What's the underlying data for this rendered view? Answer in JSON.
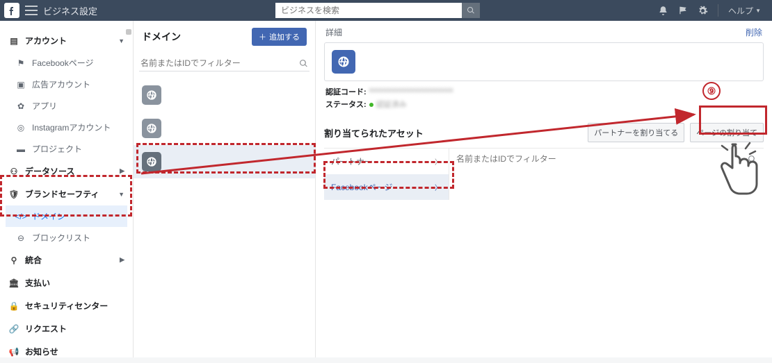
{
  "topbar": {
    "title": "ビジネス設定",
    "search_placeholder": "ビジネスを検索",
    "help": "ヘルプ"
  },
  "sidebar": {
    "accounts": {
      "label": "アカウント",
      "items": [
        {
          "label": "Facebookページ"
        },
        {
          "label": "広告アカウント"
        },
        {
          "label": "アプリ"
        },
        {
          "label": "Instagramアカウント"
        },
        {
          "label": "プロジェクト"
        }
      ]
    },
    "datasource": {
      "label": "データソース"
    },
    "brandsafety": {
      "label": "ブランドセーフティ",
      "items": [
        {
          "label": "ドメイン"
        },
        {
          "label": "ブロックリスト"
        }
      ]
    },
    "integration": {
      "label": "統合"
    },
    "other": [
      {
        "label": "支払い"
      },
      {
        "label": "セキュリティセンター"
      },
      {
        "label": "リクエスト"
      },
      {
        "label": "お知らせ"
      }
    ]
  },
  "domains": {
    "title": "ドメイン",
    "add_label": "追加する",
    "filter_placeholder": "名前またはIDでフィルター"
  },
  "detail": {
    "header_label": "詳細",
    "delete_label": "削除",
    "auth_code_label": "認証コード:",
    "auth_code_value": "xxxxxxxxxxxxxxxxxxxxxx",
    "status_label": "ステータス:",
    "status_value": "認証済み",
    "assigned_title": "割り当てられたアセット",
    "assign_partner": "パートナーを割り当てる",
    "assign_page": "ページの割り当て",
    "cat_partner": "パートナー",
    "cat_fbpage": "Facebookページ",
    "filter2_placeholder": "名前またはIDでフィルター"
  },
  "annotation": {
    "step": "⑨"
  }
}
